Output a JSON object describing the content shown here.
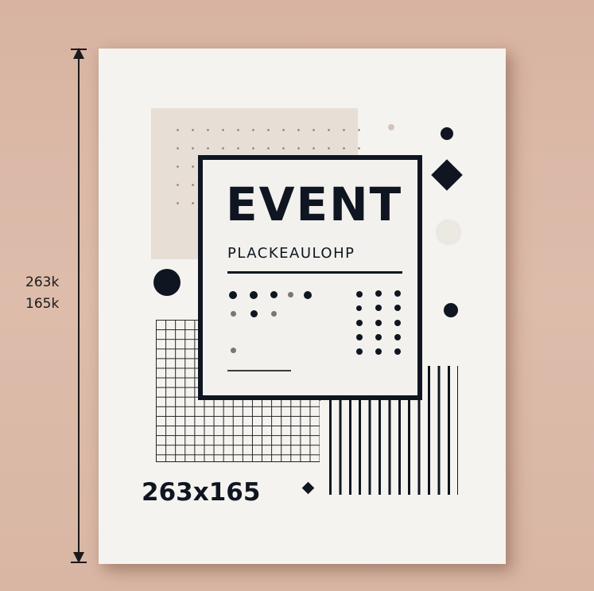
{
  "poster": {
    "title": "EVENT",
    "subtitle": "PLACKEAULOHP",
    "size_label": "263x165"
  },
  "dimension": {
    "line1": "263k",
    "line2": "165k"
  }
}
